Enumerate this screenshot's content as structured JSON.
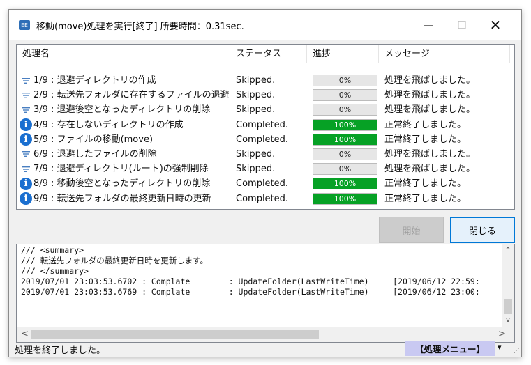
{
  "window": {
    "title": "移動(move)処理を実行[終了] 所要時間：0.31sec.",
    "app_icon_text": "EE",
    "min_glyph": "—",
    "max_glyph": "☐",
    "close_glyph": "✕"
  },
  "listview": {
    "columns": [
      "処理名",
      "ステータス",
      "進捗",
      "メッセージ"
    ],
    "rows": [
      {
        "icon": "lines-icon",
        "name": "1/9 : 退避ディレクトリの作成",
        "status": "Skipped.",
        "progress": 0,
        "progress_label": "0%",
        "message": "処理を飛ばしました。"
      },
      {
        "icon": "lines-icon",
        "name": "2/9 : 転送先フォルダに存在するファイルの退避",
        "status": "Skipped.",
        "progress": 0,
        "progress_label": "0%",
        "message": "処理を飛ばしました。"
      },
      {
        "icon": "lines-icon",
        "name": "3/9 : 退避後空となったディレクトリの削除",
        "status": "Skipped.",
        "progress": 0,
        "progress_label": "0%",
        "message": "処理を飛ばしました。"
      },
      {
        "icon": "info-icon",
        "name": "4/9 : 存在しないディレクトリの作成",
        "status": "Completed.",
        "progress": 100,
        "progress_label": "100%",
        "message": "正常終了しました。"
      },
      {
        "icon": "info-icon",
        "name": "5/9 : ファイルの移動(move)",
        "status": "Completed.",
        "progress": 100,
        "progress_label": "100%",
        "message": "正常終了しました。"
      },
      {
        "icon": "lines-icon",
        "name": "6/9 : 退避したファイルの削除",
        "status": "Skipped.",
        "progress": 0,
        "progress_label": "0%",
        "message": "処理を飛ばしました。"
      },
      {
        "icon": "lines-icon",
        "name": "7/9 : 退避ディレクトリ(ルート)の強制削除",
        "status": "Skipped.",
        "progress": 0,
        "progress_label": "0%",
        "message": "処理を飛ばしました。"
      },
      {
        "icon": "info-icon",
        "name": "8/9 : 移動後空となったディレクトリの削除",
        "status": "Completed.",
        "progress": 100,
        "progress_label": "100%",
        "message": "正常終了しました。"
      },
      {
        "icon": "info-icon",
        "name": "9/9 : 転送先フォルダの最終更新日時の更新",
        "status": "Completed.",
        "progress": 100,
        "progress_label": "100%",
        "message": "正常終了しました。"
      }
    ]
  },
  "buttons": {
    "start_label": "開始",
    "close_label": "閉じる"
  },
  "log": {
    "lines": [
      "/// <summary>",
      "/// 転送先フォルダの最終更新日時を更新します。",
      "/// </summary>",
      "2019/07/01 23:03:53.6702 : Complate        : UpdateFolder(LastWriteTime)     [2019/06/12 22:59:",
      "2019/07/01 23:03:53.6769 : Complate        : UpdateFolder(LastWriteTime)     [2019/06/12 23:00:"
    ],
    "up_arrow": "^",
    "down_arrow": "v",
    "left_arrow": "<",
    "right_arrow": ">"
  },
  "statusbar": {
    "text": "処理を終了しました。",
    "menu_label": "【処理メニュー】",
    "menu_dropdown": "▾",
    "grip": "⋰"
  },
  "colors": {
    "progress_fill": "#06a125",
    "menu_bg": "#c9c9f2",
    "focus_border": "#0078d7"
  }
}
